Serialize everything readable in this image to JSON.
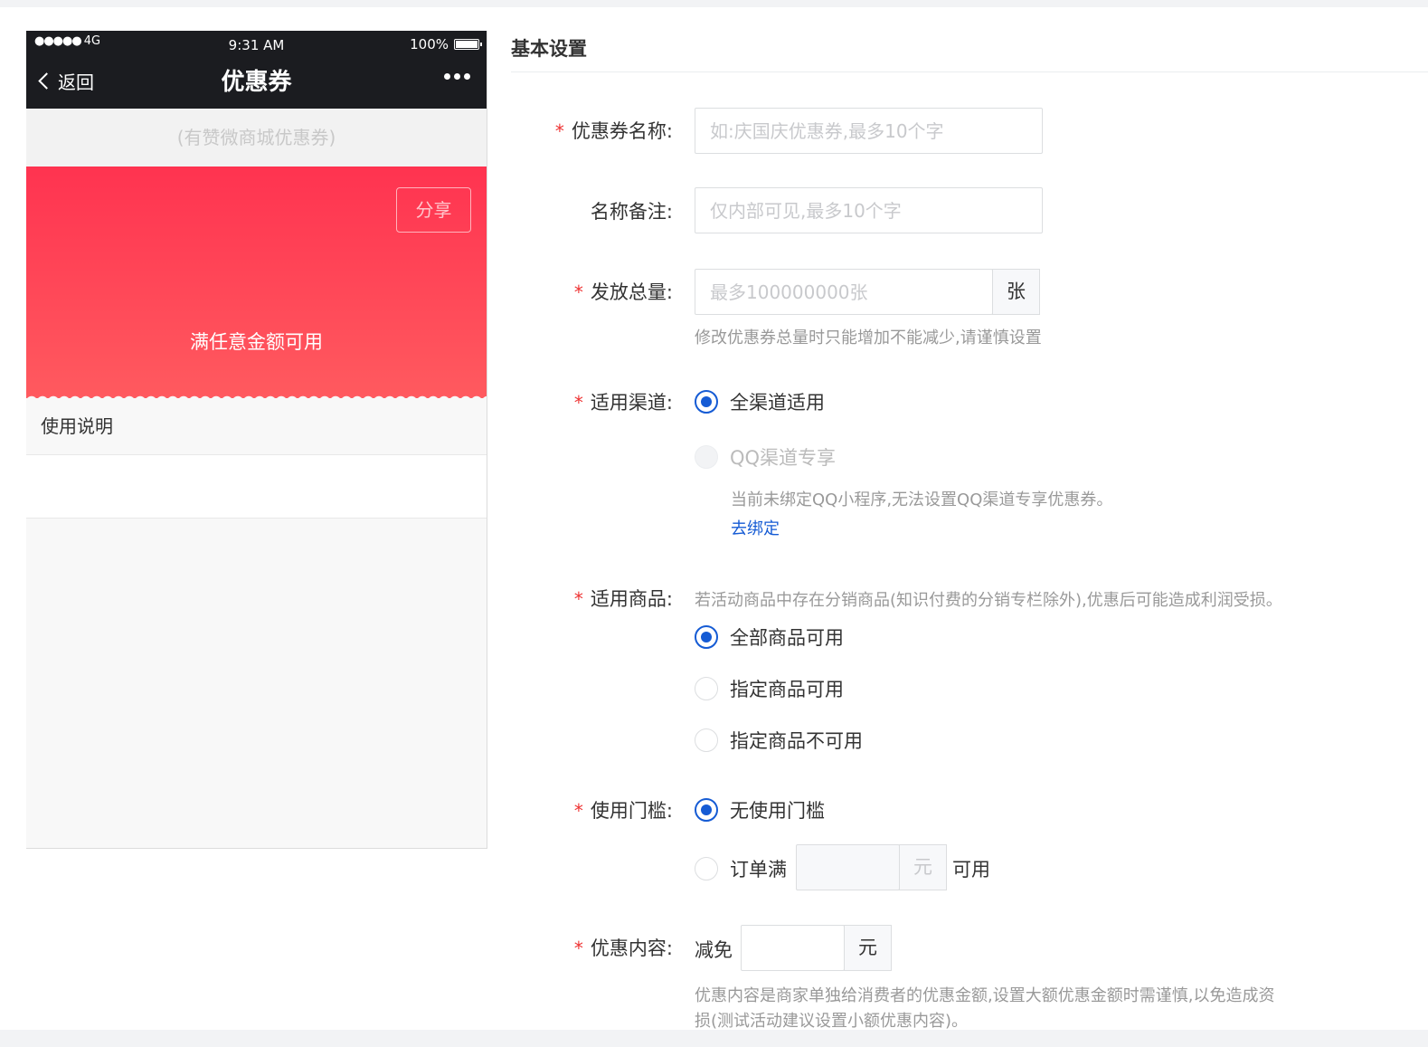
{
  "phone": {
    "status": {
      "signal": "●●●●●",
      "network": "4G",
      "time": "9:31 AM",
      "battery": "100%"
    },
    "nav": {
      "back_label": "返回",
      "title": "优惠券"
    },
    "shop_name": "(有赞微商城优惠券)",
    "coupon": {
      "share_label": "分享",
      "condition": "满任意金额可用"
    },
    "usage_title": "使用说明"
  },
  "form": {
    "section_title": "基本设置",
    "name": {
      "label": "优惠券名称:",
      "placeholder": "如:庆国庆优惠券,最多10个字"
    },
    "remark": {
      "label": "名称备注:",
      "placeholder": "仅内部可见,最多10个字"
    },
    "total": {
      "label": "发放总量:",
      "placeholder": "最多100000000张",
      "unit": "张",
      "help": "修改优惠券总量时只能增加不能减少,请谨慎设置"
    },
    "channel": {
      "label": "适用渠道:",
      "options": [
        "全渠道适用",
        "QQ渠道专享"
      ],
      "selected": "全渠道适用",
      "qq_note": "当前未绑定QQ小程序,无法设置QQ渠道专享优惠券。",
      "bind_link": "去绑定"
    },
    "goods": {
      "label": "适用商品:",
      "notice": "若活动商品中存在分销商品(知识付费的分销专栏除外),优惠后可能造成利润受损。",
      "options": [
        "全部商品可用",
        "指定商品可用",
        "指定商品不可用"
      ],
      "selected": "全部商品可用"
    },
    "threshold": {
      "label": "使用门槛:",
      "options": [
        "无使用门槛",
        "订单满"
      ],
      "selected": "无使用门槛",
      "unit": "元",
      "suffix": "可用"
    },
    "discount": {
      "label": "优惠内容:",
      "prefix": "减免",
      "unit": "元",
      "help_line1": "优惠内容是商家单独给消费者的优惠金额,设置大额优惠金额时需谨慎,以免造成资",
      "help_line2": "损(测试活动建议设置小额优惠内容)。"
    }
  },
  "colors": {
    "primary": "#155bd4",
    "required": "#ee3333",
    "coupon_top": "#ff3350",
    "coupon_bottom": "#ff5a5f",
    "phone_header": "#1b1c20"
  }
}
